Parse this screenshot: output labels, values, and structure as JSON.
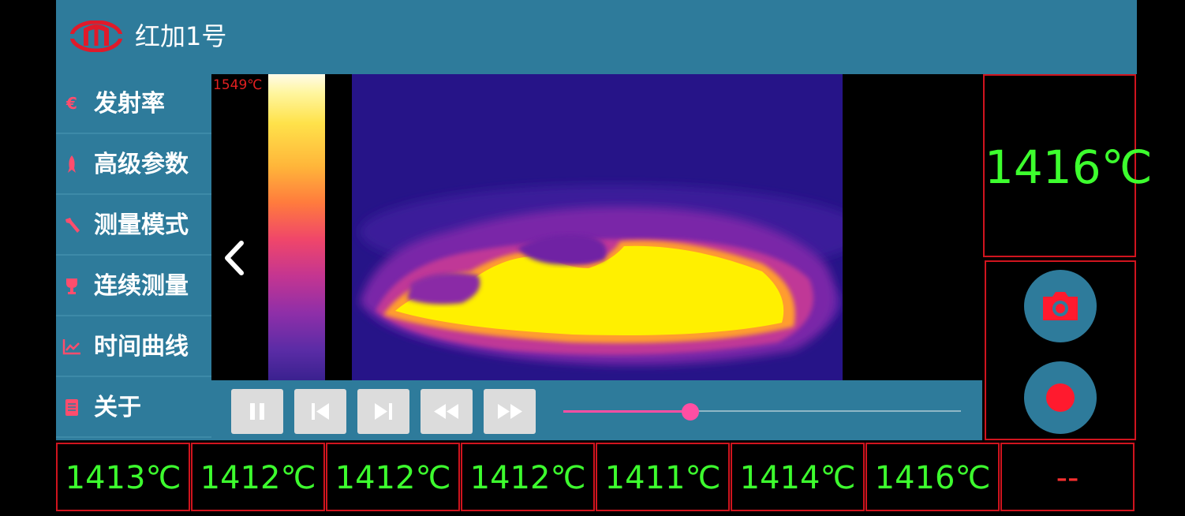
{
  "header": {
    "title": "红加1号",
    "logo_icon": "brand-logo-icon"
  },
  "sidebar": {
    "items": [
      {
        "label": "发射率",
        "icon": "epsilon-icon"
      },
      {
        "label": "高级参数",
        "icon": "rocket-icon"
      },
      {
        "label": "测量模式",
        "icon": "tool-icon"
      },
      {
        "label": "连续测量",
        "icon": "trophy-icon"
      },
      {
        "label": "时间曲线",
        "icon": "chart-icon"
      },
      {
        "label": "关于",
        "icon": "document-icon"
      }
    ]
  },
  "viewer": {
    "scale_max": "1549℃"
  },
  "playback": {
    "buttons": [
      "pause-icon",
      "skip-previous-icon",
      "skip-next-icon",
      "rewind-icon",
      "fast-forward-icon"
    ],
    "progress": 0.32
  },
  "current_temp": "1416℃",
  "actions": [
    "camera-icon",
    "record-icon"
  ],
  "readings": [
    "1413℃",
    "1412℃",
    "1412℃",
    "1412℃",
    "1411℃",
    "1414℃",
    "1416℃",
    "--"
  ],
  "colors": {
    "accent": "#2e7b9b",
    "temp_green": "#3dff2e",
    "border_red": "#d0141e",
    "slider_pink": "#ff4fa3"
  }
}
